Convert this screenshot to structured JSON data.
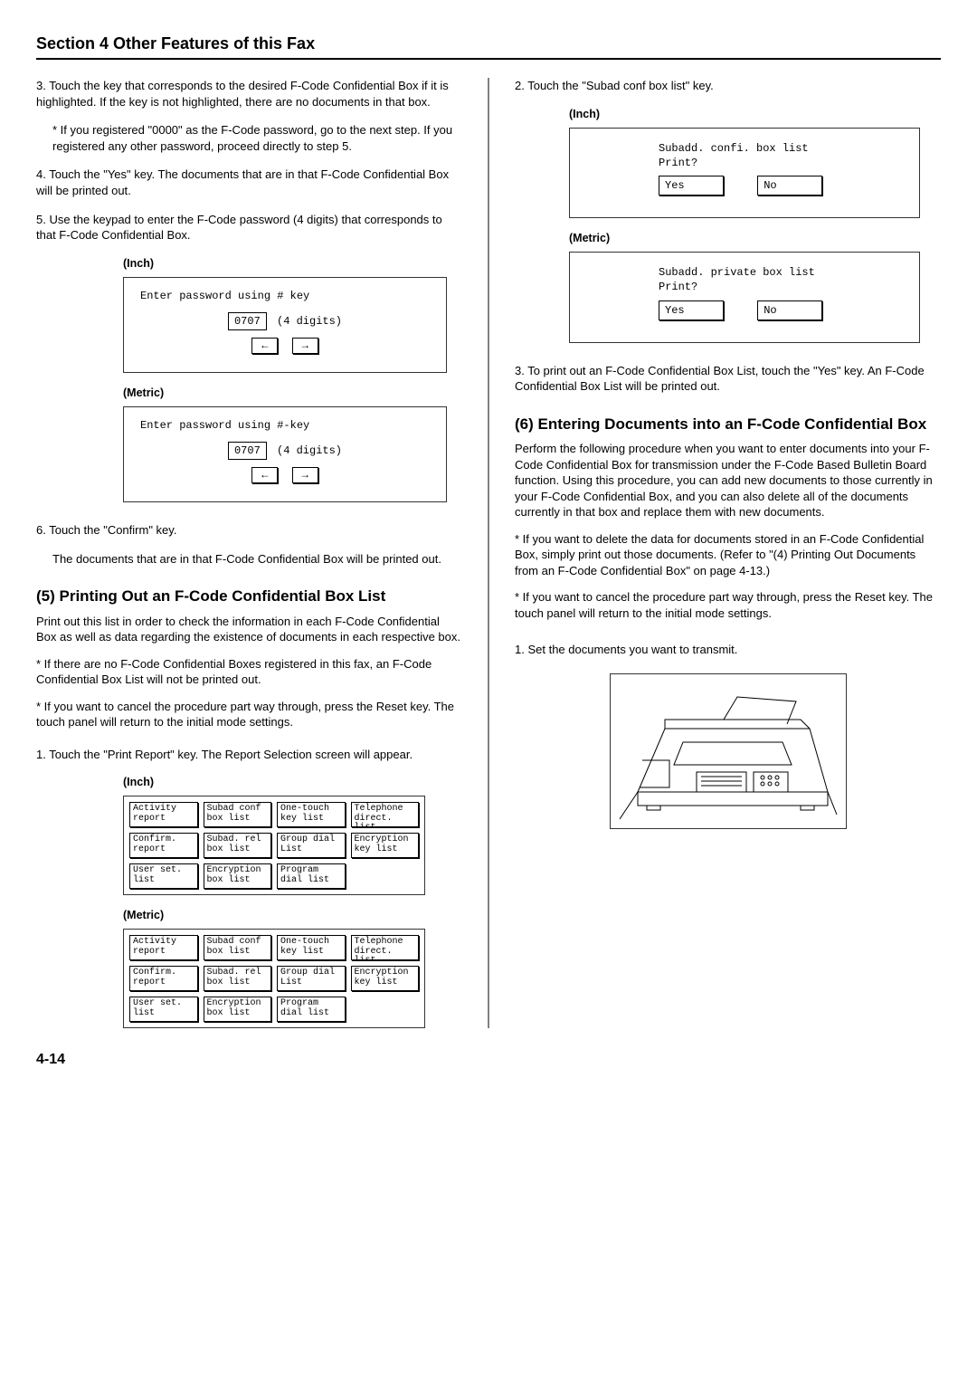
{
  "section_title": "Section 4 Other Features of this Fax",
  "left": {
    "step3": "3. Touch the key that corresponds to the desired F-Code Confidential Box if it is highlighted. If the key is not highlighted, there are no documents in that box.",
    "step3_note": "* If you registered \"0000\" as the F-Code password, go to the next step. If you registered any other password, proceed directly to step 5.",
    "step4": "4. Touch the \"Yes\" key. The documents that are in that F-Code Confidential Box will be printed out.",
    "step5": "5. Use the keypad to enter the F-Code password (4 digits) that corresponds to that F-Code Confidential Box.",
    "label_inch": "(Inch)",
    "label_metric": "(Metric)",
    "scr_inch_title": "Enter password using # key",
    "scr_metric_title": "Enter password using #-key",
    "scr_pw": "0707",
    "scr_digits": "(4 digits)",
    "step6": "6. Touch the \"Confirm\" key.",
    "step6_sub": "The documents that are in that F-Code Confidential Box will be printed out.",
    "h5": "(5) Printing Out an F-Code Confidential Box List",
    "h5_body": "Print out this list in order to check the information in each F-Code Confidential Box as well as data regarding the existence of documents in each respective box.",
    "h5_n1": "* If there are no F-Code Confidential Boxes registered in this fax, an F-Code Confidential Box List will not be printed out.",
    "h5_n2": "* If you want to cancel the procedure part way through, press the Reset key. The touch panel will return to the initial mode settings.",
    "step1": "1. Touch the \"Print Report\" key. The Report Selection screen will appear.",
    "keys": {
      "r1": [
        "Activity\nreport",
        "Subad conf\nbox list",
        "One-touch\nkey list",
        "Telephone\ndirect. list"
      ],
      "r2": [
        "Confirm.\nreport",
        "Subad. rel\nbox list",
        "Group dial\nList",
        "Encryption\nkey list"
      ],
      "r3": [
        "User set.\nlist",
        "Encryption\nbox list",
        "Program\ndial list",
        ""
      ]
    }
  },
  "right": {
    "step2": "2. Touch the \"Subad conf box list\" key.",
    "label_inch": "(Inch)",
    "label_metric": "(Metric)",
    "scr_inch_t": "Subadd. confi. box list",
    "scr_metric_t": "Subadd. private box list",
    "scr_q": "Print?",
    "yes": "Yes",
    "no": "No",
    "step3": "3. To print out an F-Code Confidential Box List, touch the \"Yes\" key. An F-Code Confidential Box List will be printed out.",
    "h6": "(6) Entering Documents into an F-Code Confidential Box",
    "h6_body": "Perform the following procedure when you want to enter documents into your F-Code Confidential Box for transmission under the F-Code Based Bulletin Board function. Using this procedure, you can add new documents to those currently in your F-Code Confidential Box, and you can also delete all of the documents currently in that box and replace them with new documents.",
    "h6_n1": "* If you want to delete the data for documents stored in an F-Code Confidential Box, simply print out those documents. (Refer to \"(4) Printing Out Documents from an F-Code Confidential Box\" on page 4-13.)",
    "h6_n2": "* If you want to cancel the procedure part way through, press the Reset key. The touch panel will return to the initial mode settings.",
    "step1": "1. Set the documents you want to transmit."
  },
  "page_num": "4-14"
}
